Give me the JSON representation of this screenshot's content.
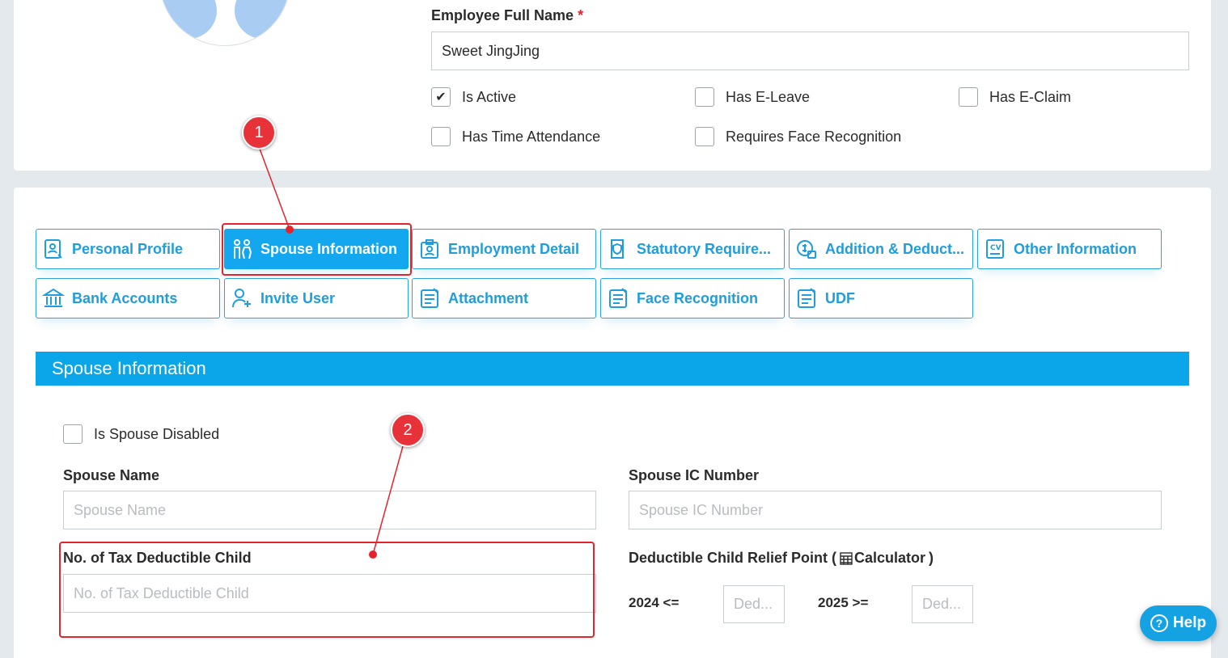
{
  "employee": {
    "full_name_label": "Employee Full Name",
    "required_mark": "*",
    "full_name_value": "Sweet JingJing"
  },
  "flags": [
    {
      "label": "Is Active",
      "checked": true
    },
    {
      "label": "Has E-Leave",
      "checked": false
    },
    {
      "label": "Has E-Claim",
      "checked": false
    },
    {
      "label": "Has Time Attendance",
      "checked": false
    },
    {
      "label": "Requires Face Recognition",
      "checked": false
    }
  ],
  "tabs": [
    {
      "label": "Personal Profile",
      "icon": "profile-icon",
      "active": false
    },
    {
      "label": "Spouse Information",
      "icon": "couple-icon",
      "active": true
    },
    {
      "label": "Employment Detail",
      "icon": "badge-icon",
      "active": false
    },
    {
      "label": "Statutory Require...",
      "icon": "shield-doc-icon",
      "active": false
    },
    {
      "label": "Addition & Deduct...",
      "icon": "money-icon",
      "active": false
    },
    {
      "label": "Other Information",
      "icon": "cv-icon",
      "active": false
    },
    {
      "label": "Bank Accounts",
      "icon": "bank-icon",
      "active": false
    },
    {
      "label": "Invite User",
      "icon": "add-user-icon",
      "active": false
    },
    {
      "label": "Attachment",
      "icon": "document-icon",
      "active": false
    },
    {
      "label": "Face Recognition",
      "icon": "document-icon",
      "active": false
    },
    {
      "label": "UDF",
      "icon": "document-icon",
      "active": false
    }
  ],
  "spouse": {
    "section_title": "Spouse Information",
    "disabled_label": "Is Spouse Disabled",
    "name_label": "Spouse Name",
    "name_placeholder": "Spouse Name",
    "ic_label": "Spouse IC Number",
    "ic_placeholder": "Spouse IC Number",
    "child_label": "No. of Tax Deductible Child",
    "child_placeholder": "No. of Tax Deductible Child",
    "relief_label_prefix": "Deductible Child Relief Point (",
    "relief_link": "Calculator",
    "relief_label_suffix": ")",
    "year_2024_label": "2024 <=",
    "year_2024_placeholder": "Ded...",
    "year_2025_label": "2025 >=",
    "year_2025_placeholder": "Ded..."
  },
  "annotations": {
    "step1": "1",
    "step2": "2"
  },
  "help": {
    "label": "Help",
    "icon": "question-circle-icon"
  },
  "colors": {
    "accent": "#12a7ee",
    "annotation": "#e5232c",
    "avatar": "#a9cdf2"
  }
}
